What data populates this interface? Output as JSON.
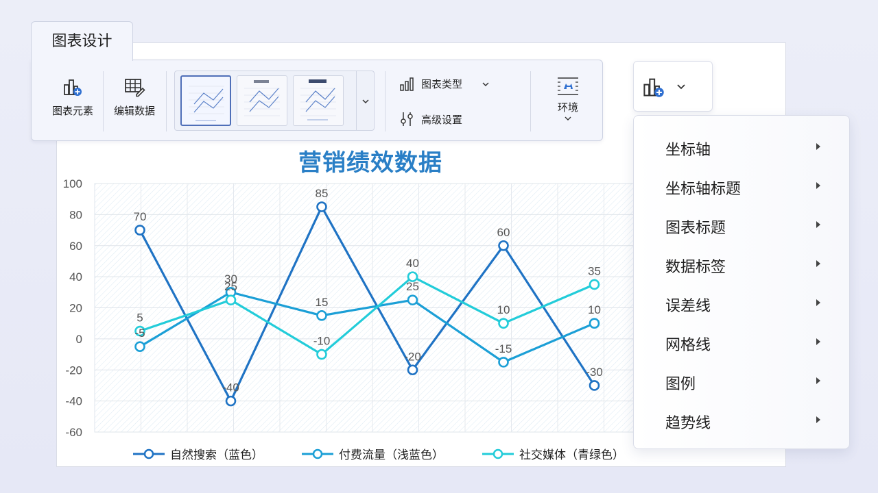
{
  "ribbon": {
    "tab_label": "图表设计",
    "add_element_label": "图表元素",
    "edit_data_label": "编辑数据",
    "chart_type_label": "图表类型",
    "advanced_settings_label": "高级设置",
    "environment_label": "环境"
  },
  "menu": {
    "items": [
      {
        "label": "坐标轴"
      },
      {
        "label": "坐标轴标题"
      },
      {
        "label": "图表标题"
      },
      {
        "label": "数据标签"
      },
      {
        "label": "误差线"
      },
      {
        "label": "网格线"
      },
      {
        "label": "图例"
      },
      {
        "label": "趋势线"
      }
    ]
  },
  "chart_data": {
    "type": "line",
    "title": "营销绩效数据",
    "ylim": [
      -60,
      100
    ],
    "yticks": [
      100,
      80,
      60,
      40,
      20,
      0,
      -20,
      -40,
      -60
    ],
    "x": [
      1,
      2,
      3,
      4,
      5,
      6
    ],
    "grid": true,
    "legend_position": "bottom",
    "series": [
      {
        "name": "自然搜索（蓝色）",
        "color": "#1f73c4",
        "values": [
          70,
          -40,
          85,
          -20,
          60,
          -30
        ]
      },
      {
        "name": "付费流量（浅蓝色）",
        "color": "#1b9fd6",
        "values": [
          -5,
          30,
          15,
          25,
          -15,
          10
        ]
      },
      {
        "name": "社交媒体（青绿色）",
        "color": "#22ccd9",
        "values": [
          5,
          25,
          -10,
          40,
          10,
          35
        ]
      }
    ]
  }
}
